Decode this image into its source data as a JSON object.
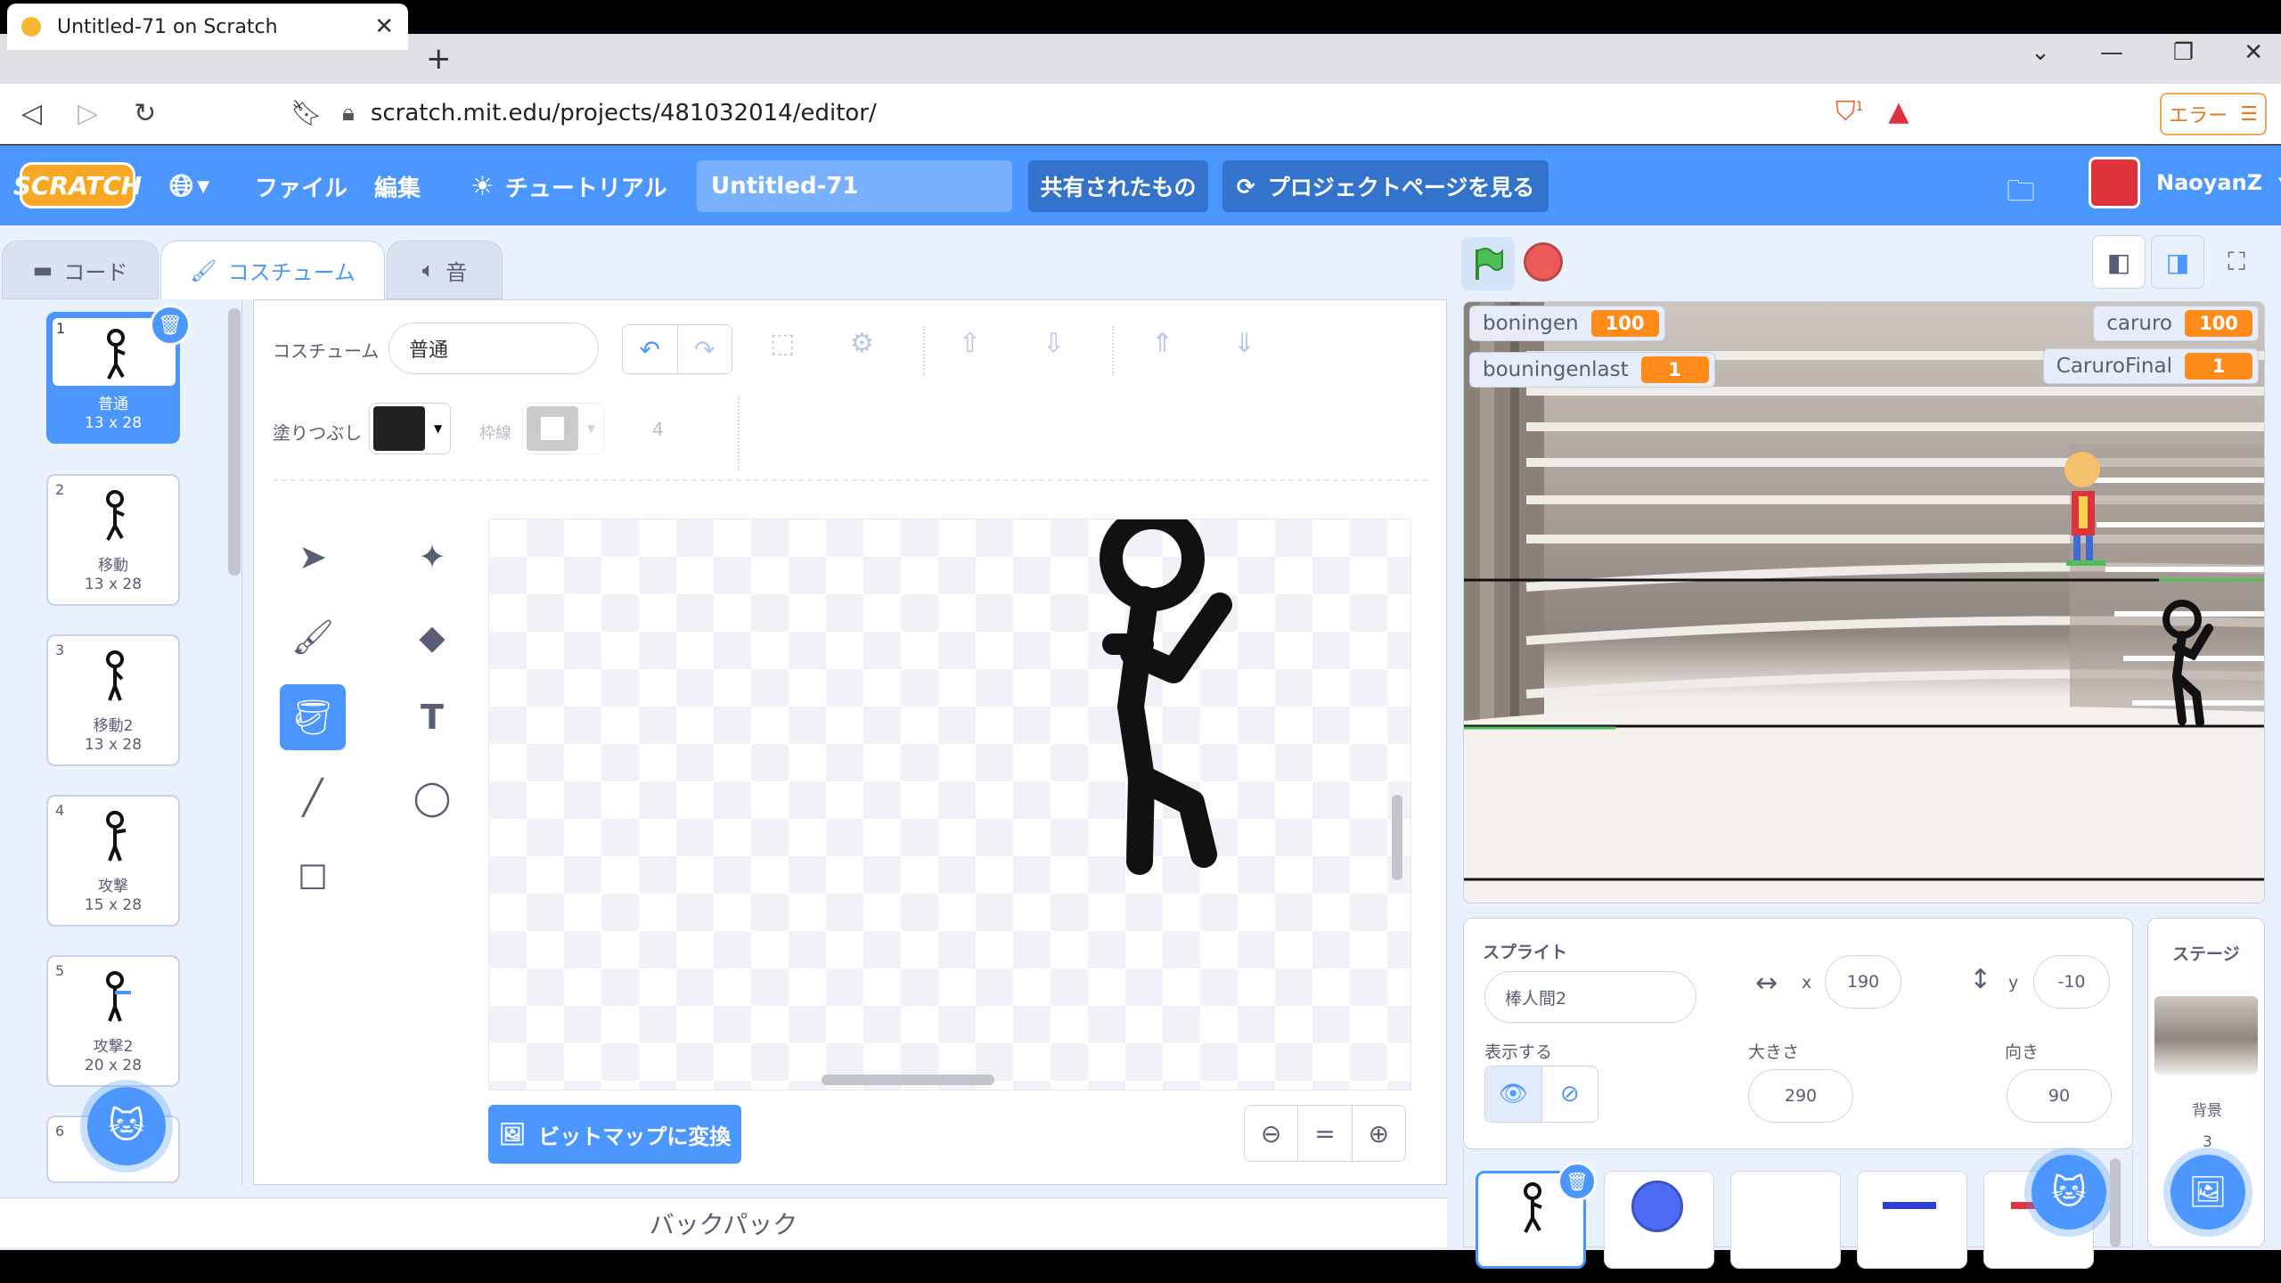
{
  "browser": {
    "tab_title": "Untitled-71 on Scratch",
    "tab_close": "✕",
    "new_tab": "+",
    "url": "scratch.mit.edu/projects/481032014/editor/",
    "error_label": "エラー",
    "brave_badge": "1"
  },
  "menu": {
    "logo": "SCRATCH",
    "file": "ファイル",
    "edit": "編集",
    "tutorial": "チュートリアル",
    "project_title": "Untitled-71",
    "share": "共有されたもの",
    "project_page": "プロジェクトページを見る",
    "username": "NaoyanZ"
  },
  "tabs": {
    "code": "コード",
    "costume": "コスチューム",
    "sound": "音"
  },
  "costumes": [
    {
      "num": "1",
      "name": "普通",
      "size": "13 x 28"
    },
    {
      "num": "2",
      "name": "移動",
      "size": "13 x 28"
    },
    {
      "num": "3",
      "name": "移動2",
      "size": "13 x 28"
    },
    {
      "num": "4",
      "name": "攻撃",
      "size": "15 x 28"
    },
    {
      "num": "5",
      "name": "攻撃2",
      "size": "20 x 28"
    },
    {
      "num": "6"
    }
  ],
  "paint": {
    "costume_label": "コスチューム",
    "costume_name": "普通",
    "fill_label": "塗りつぶし",
    "stroke_label": "枠線",
    "stroke_width": "4",
    "convert_bitmap": "ビットマップに変換",
    "fill_color": "#222222"
  },
  "backpack": "バックパック",
  "monitors": [
    {
      "name": "boningen",
      "value": "100"
    },
    {
      "name": "bouningenlast",
      "value": "1"
    },
    {
      "name": "caruro",
      "value": "100"
    },
    {
      "name": "CaruroFinal",
      "value": "1"
    }
  ],
  "sprite": {
    "section_label": "スプライト",
    "name": "棒人間2",
    "x_label": "x",
    "x": "190",
    "y_label": "y",
    "y": "-10",
    "show_label": "表示する",
    "size_label": "大きさ",
    "size": "290",
    "direction_label": "向き",
    "direction": "90"
  },
  "stage_panel": {
    "label": "ステージ",
    "backdrop_label": "背景",
    "backdrop_count": "3"
  }
}
